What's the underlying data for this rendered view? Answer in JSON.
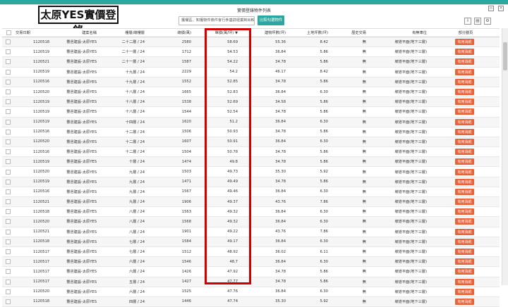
{
  "page_title": "實價登錄物件列表",
  "overlay_title": "太原YES實價登錄",
  "search": {
    "value": "獲權區、知獲物件條件會行參基詳經業制出較"
  },
  "compare_button": "比較勾選物件",
  "columns": [
    "交易日期",
    "建案名稱",
    "樓層/總樓層",
    "總價(萬)",
    "單價(萬/坪)",
    "建物坪數(坪)",
    "土地坪數(坪)",
    "歷史交易",
    "有無車位",
    "部分謄頁"
  ],
  "sort_indicator": "▼",
  "rows": [
    {
      "date": "1120518",
      "name": "豐邑建設-太原YES",
      "floor": "二十二層 / 24",
      "total": "2580",
      "unit": "58.69",
      "building": "55.36",
      "land": "8.42",
      "history": "無",
      "parking": "坡道平面(地下三層)",
      "tag": "有用消紙"
    },
    {
      "date": "1120519",
      "name": "豐邑建設-太原YES",
      "floor": "二十一層 / 24",
      "total": "1712",
      "unit": "54.53",
      "building": "36.84",
      "land": "5.86",
      "history": "無",
      "parking": "坡道平面(地下三層)",
      "tag": "有用消紙"
    },
    {
      "date": "1120521",
      "name": "豐邑建設-太原YES",
      "floor": "二十一層 / 24",
      "total": "1587",
      "unit": "54.22",
      "building": "34.78",
      "land": "5.86",
      "history": "無",
      "parking": "坡道平面(地下三層)",
      "tag": "有用消紙"
    },
    {
      "date": "1120519",
      "name": "豐邑建設-太原YES",
      "floor": "十九層 / 24",
      "total": "2229",
      "unit": "54.2",
      "building": "46.17",
      "land": "8.42",
      "history": "無",
      "parking": "坡道平面(地下三層)",
      "tag": "有用消紙"
    },
    {
      "date": "1120516",
      "name": "豐邑建設-太原YES",
      "floor": "十九層 / 24",
      "total": "1552",
      "unit": "52.85",
      "building": "34.78",
      "land": "5.86",
      "history": "無",
      "parking": "坡道平面(地下三層)",
      "tag": "有用消紙"
    },
    {
      "date": "1120520",
      "name": "豐邑建設-太原YES",
      "floor": "十八層 / 24",
      "total": "1665",
      "unit": "52.83",
      "building": "36.84",
      "land": "6.30",
      "history": "無",
      "parking": "坡道平面(地下三層)",
      "tag": "有用消紙"
    },
    {
      "date": "1120519",
      "name": "豐邑建設-太原YES",
      "floor": "十八層 / 24",
      "total": "1538",
      "unit": "52.69",
      "building": "34.58",
      "land": "5.86",
      "history": "無",
      "parking": "坡道平面(地下三層)",
      "tag": "有用消紙"
    },
    {
      "date": "1120519",
      "name": "豐邑建設-太原YES",
      "floor": "十八層 / 24",
      "total": "1544",
      "unit": "52.54",
      "building": "34.78",
      "land": "5.86",
      "history": "無",
      "parking": "坡道平面(地下三層)",
      "tag": "有用消紙"
    },
    {
      "date": "1120519",
      "name": "豐邑建設-太原YES",
      "floor": "十四層 / 24",
      "total": "1620",
      "unit": "51.2",
      "building": "36.84",
      "land": "6.30",
      "history": "無",
      "parking": "坡道平面(地下三層)",
      "tag": "有用消紙"
    },
    {
      "date": "1120516",
      "name": "豐邑建設-太原YES",
      "floor": "十二層 / 24",
      "total": "1506",
      "unit": "50.93",
      "building": "34.78",
      "land": "5.86",
      "history": "無",
      "parking": "坡道平面(地下三層)",
      "tag": "有用消紙"
    },
    {
      "date": "1120520",
      "name": "豐邑建設-太原YES",
      "floor": "十二層 / 24",
      "total": "1607",
      "unit": "50.91",
      "building": "36.84",
      "land": "6.30",
      "history": "無",
      "parking": "坡道平面(地下三層)",
      "tag": "有用消紙"
    },
    {
      "date": "1120516",
      "name": "豐邑建設-太原YES",
      "floor": "十二層 / 24",
      "total": "1504",
      "unit": "50.78",
      "building": "34.78",
      "land": "5.86",
      "history": "無",
      "parking": "坡道平面(地下三層)",
      "tag": "有用消紙"
    },
    {
      "date": "1120519",
      "name": "豐邑建設-太原YES",
      "floor": "十層 / 24",
      "total": "1474",
      "unit": "49.8",
      "building": "34.78",
      "land": "5.86",
      "history": "無",
      "parking": "坡道平面(地下三層)",
      "tag": "有用消紙"
    },
    {
      "date": "1120520",
      "name": "豐邑建設-太原YES",
      "floor": "九層 / 24",
      "total": "1503",
      "unit": "49.73",
      "building": "35.30",
      "land": "5.92",
      "history": "無",
      "parking": "坡道平面(地下三層)",
      "tag": "有用消紙"
    },
    {
      "date": "1120519",
      "name": "豐邑建設-太原YES",
      "floor": "九層 / 24",
      "total": "1471",
      "unit": "49.49",
      "building": "34.78",
      "land": "5.86",
      "history": "無",
      "parking": "坡道平面(地下三層)",
      "tag": "有用消紙"
    },
    {
      "date": "1120516",
      "name": "豐邑建設-太原YES",
      "floor": "九層 / 24",
      "total": "1567",
      "unit": "49.46",
      "building": "36.84",
      "land": "6.30",
      "history": "無",
      "parking": "坡道平面(地下三層)",
      "tag": "有用消紙"
    },
    {
      "date": "1120521",
      "name": "豐邑建設-太原YES",
      "floor": "九層 / 24",
      "total": "1906",
      "unit": "49.37",
      "building": "43.76",
      "land": "7.86",
      "history": "無",
      "parking": "坡道平面(地下三層)",
      "tag": "有用消紙"
    },
    {
      "date": "1120518",
      "name": "豐邑建設-太原YES",
      "floor": "八層 / 24",
      "total": "1563",
      "unit": "49.32",
      "building": "36.84",
      "land": "6.30",
      "history": "無",
      "parking": "坡道平面(地下三層)",
      "tag": "有用消紙"
    },
    {
      "date": "1120520",
      "name": "豐邑建設-太原YES",
      "floor": "八層 / 24",
      "total": "1568",
      "unit": "49.32",
      "building": "36.84",
      "land": "6.30",
      "history": "無",
      "parking": "坡道平面(地下三層)",
      "tag": "有用消紙"
    },
    {
      "date": "1120521",
      "name": "豐邑建設-太原YES",
      "floor": "八層 / 24",
      "total": "1901",
      "unit": "49.22",
      "building": "43.76",
      "land": "7.86",
      "history": "無",
      "parking": "坡道平面(地下三層)",
      "tag": "有用消紙"
    },
    {
      "date": "1120518",
      "name": "豐邑建設-太原YES",
      "floor": "七層 / 24",
      "total": "1584",
      "unit": "49.17",
      "building": "36.84",
      "land": "6.30",
      "history": "無",
      "parking": "坡道平面(地下三層)",
      "tag": "有用消紙"
    },
    {
      "date": "1120517",
      "name": "豐邑建設-太原YES",
      "floor": "七層 / 24",
      "total": "1512",
      "unit": "48.92",
      "building": "36.02",
      "land": "6.11",
      "history": "無",
      "parking": "坡道平面(地下三層)",
      "tag": "有用消紙"
    },
    {
      "date": "1120517",
      "name": "豐邑建設-太原YES",
      "floor": "六層 / 24",
      "total": "1546",
      "unit": "48.7",
      "building": "36.84",
      "land": "6.30",
      "history": "無",
      "parking": "坡道平面(地下三層)",
      "tag": "有用消紙"
    },
    {
      "date": "1120517",
      "name": "豐邑建設-太原YES",
      "floor": "六層 / 24",
      "total": "1426",
      "unit": "47.92",
      "building": "34.78",
      "land": "5.86",
      "history": "無",
      "parking": "坡道平面(地下三層)",
      "tag": "有用消紙"
    },
    {
      "date": "1120517",
      "name": "豐邑建設-太原YES",
      "floor": "五層 / 24",
      "total": "1427",
      "unit": "47.77",
      "building": "34.78",
      "land": "5.86",
      "history": "無",
      "parking": "坡道平面(地下三層)",
      "tag": "有用消紙"
    },
    {
      "date": "1120520",
      "name": "豐邑建設-太原YES",
      "floor": "六層 / 24",
      "total": "1525",
      "unit": "47.76",
      "building": "36.84",
      "land": "6.30",
      "history": "無",
      "parking": "坡道平面(地下三層)",
      "tag": "有用消紙"
    },
    {
      "date": "1120518",
      "name": "豐邑建設-太原YES",
      "floor": "四層 / 24",
      "total": "1446",
      "unit": "47.74",
      "building": "35.30",
      "land": "5.92",
      "history": "無",
      "parking": "坡道平面(地下三層)",
      "tag": "有用消紙"
    }
  ]
}
